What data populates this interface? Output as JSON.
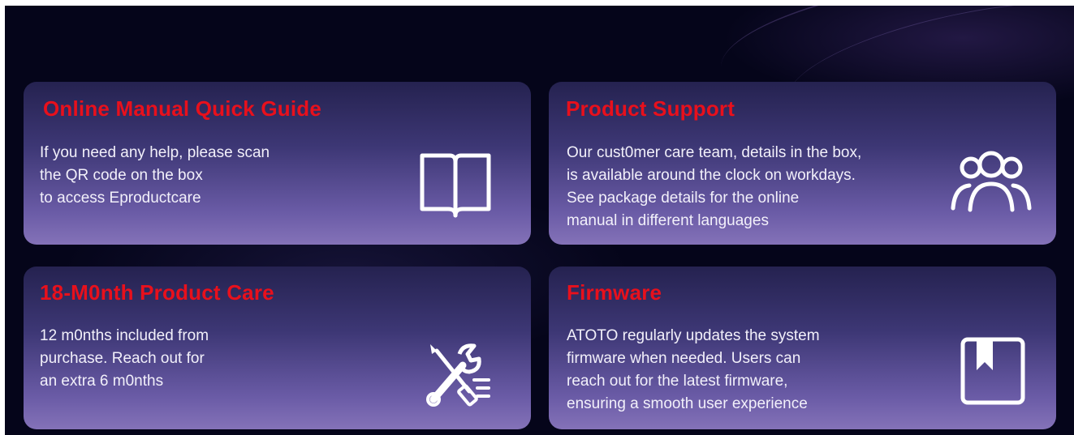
{
  "cards": [
    {
      "title": "Online Manual Quick Guide",
      "lines": [
        "If you need any help, please scan",
        "the QR code on the box",
        "to access Eproductcare"
      ],
      "icon": "book-icon"
    },
    {
      "title": "Product Support",
      "lines": [
        "Our cust0mer care team, details in the box,",
        "is available around the clock on workdays.",
        "See package details for the online",
        "manual in different languages"
      ],
      "icon": "users-icon"
    },
    {
      "title": "18-M0nth Product Care",
      "lines": [
        "12 m0nths included from",
        "purchase. Reach out for",
        "an extra 6 m0nths"
      ],
      "icon": "tools-icon"
    },
    {
      "title": "Firmware",
      "lines": [
        "ATOTO regularly updates the system",
        "firmware when needed. Users can",
        "reach out for the latest firmware,",
        "ensuring a smooth user experience"
      ],
      "icon": "bookmark-icon"
    }
  ],
  "colors": {
    "title": "#e8101c",
    "text": "#f2f0fa",
    "background": "#05051a"
  }
}
